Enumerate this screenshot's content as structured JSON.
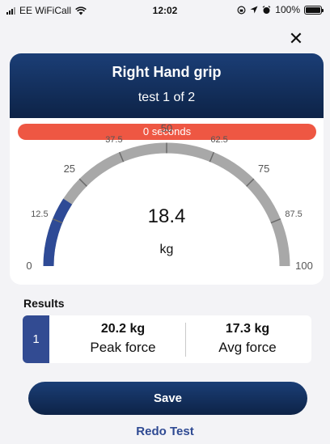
{
  "status_bar": {
    "carrier": "EE WiFiCall",
    "time": "12:02",
    "battery": "100%"
  },
  "header": {
    "title": "Right Hand grip",
    "subtitle": "test 1 of 2"
  },
  "timer": {
    "text": "0 seconds"
  },
  "gauge": {
    "value": "18.4",
    "unit": "kg",
    "reading": 18.4,
    "min": 0,
    "max": 100,
    "ticks": [
      "0",
      "12.5",
      "25",
      "37.5",
      "50",
      "62.5",
      "75",
      "87.5",
      "100"
    ],
    "colors": {
      "track": "#a8a8a8",
      "fill": "#2e4a96",
      "tick_mark": "#6a6a6a",
      "tick_label": "#555555"
    }
  },
  "results": {
    "title": "Results",
    "rows": [
      {
        "index": "1",
        "peak_value": "20.2 kg",
        "peak_label": "Peak force",
        "avg_value": "17.3 kg",
        "avg_label": "Avg force"
      }
    ]
  },
  "actions": {
    "save": "Save",
    "redo": "Redo Test",
    "close": "✕"
  },
  "colors": {
    "header_dark": "#0d2347",
    "header_light": "#1b3e76",
    "timer_red": "#ee5743",
    "accent_blue": "#2f4a93"
  }
}
